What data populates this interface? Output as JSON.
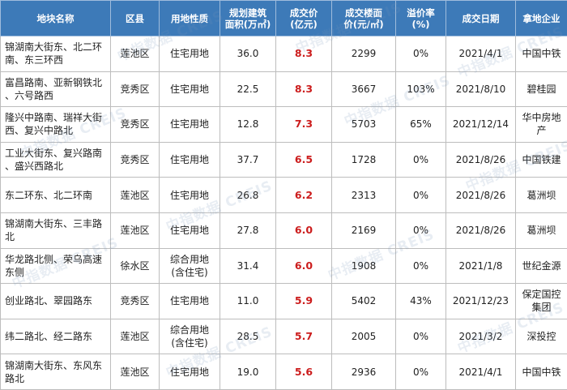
{
  "headers": [
    "地块名称",
    "区县",
    "用地性质",
    "规划建筑\n面积(万㎡)",
    "成交价\n(亿元)",
    "成交楼面\n价(元/㎡)",
    "溢价率\n(%)",
    "成交日期",
    "拿地企业"
  ],
  "rows": [
    [
      "锦湖南大街东、北二环\n南、东三环西",
      "莲池区",
      "住宅用地",
      "36.0",
      "8.3",
      "2299",
      "0%",
      "2021/4/1",
      "中国中铁"
    ],
    [
      "富昌路南、亚新钢铁北\n、六号路西",
      "竞秀区",
      "住宅用地",
      "22.5",
      "8.3",
      "3667",
      "103%",
      "2021/8/10",
      "碧桂园"
    ],
    [
      "隆兴中路南、瑞祥大街\n西、复兴中路北",
      "竞秀区",
      "住宅用地",
      "12.8",
      "7.3",
      "5703",
      "65%",
      "2021/12/14",
      "华中房地产"
    ],
    [
      "工业大街东、复兴路南\n、盛兴西路北",
      "竞秀区",
      "住宅用地",
      "37.7",
      "6.5",
      "1728",
      "0%",
      "2021/8/26",
      "中国铁建"
    ],
    [
      "东二环东、北二环南",
      "莲池区",
      "住宅用地",
      "26.8",
      "6.2",
      "2313",
      "0%",
      "2021/8/26",
      "葛洲坝"
    ],
    [
      "锦湖南大街东、三丰路\n北",
      "莲池区",
      "住宅用地",
      "27.8",
      "6.0",
      "2169",
      "0%",
      "2021/8/26",
      "葛洲坝"
    ],
    [
      "华龙路北侧、荣乌高速\n东侧",
      "徐水区",
      "综合用地\n(含住宅)",
      "31.4",
      "6.0",
      "1908",
      "0%",
      "2021/1/8",
      "世纪金源"
    ],
    [
      "创业路北、翠园路东",
      "竞秀区",
      "住宅用地",
      "11.0",
      "5.9",
      "5402",
      "43%",
      "2021/12/23",
      "保定国控\n集团"
    ],
    [
      "纬二路北、经二路东",
      "莲池区",
      "综合用地\n(含住宅)",
      "28.5",
      "5.7",
      "2005",
      "0%",
      "2021/3/2",
      "深投控"
    ],
    [
      "锦湖南大街东、东风东\n路北",
      "莲池区",
      "住宅用地",
      "19.0",
      "5.6",
      "2936",
      "0%",
      "2021/4/1",
      "中国中铁"
    ]
  ],
  "watermark": "中指数据 CREIS",
  "colors": {
    "header_bg": "#3d7ab8",
    "price_red": "#cc1d1d",
    "border": "#bdbdbd"
  }
}
